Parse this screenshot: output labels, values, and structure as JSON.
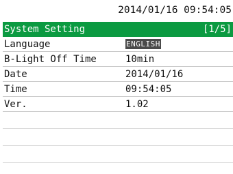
{
  "status": {
    "datetime": "2014/01/16 09:54:05"
  },
  "header": {
    "title": "System Setting",
    "page_indicator": "[1/5]"
  },
  "settings": [
    {
      "label": "Language",
      "value": "ENGLISH",
      "selected": true
    },
    {
      "label": "B-Light Off Time",
      "value": "10min"
    },
    {
      "label": "Date",
      "value": "2014/01/16"
    },
    {
      "label": "Time",
      "value": "09:54:05"
    },
    {
      "label": "Ver.",
      "value": "1.02"
    }
  ],
  "colors": {
    "title_bar": "#0b9a41",
    "selection": "#4a4a4a",
    "row_divider": "#c9c9c9"
  }
}
